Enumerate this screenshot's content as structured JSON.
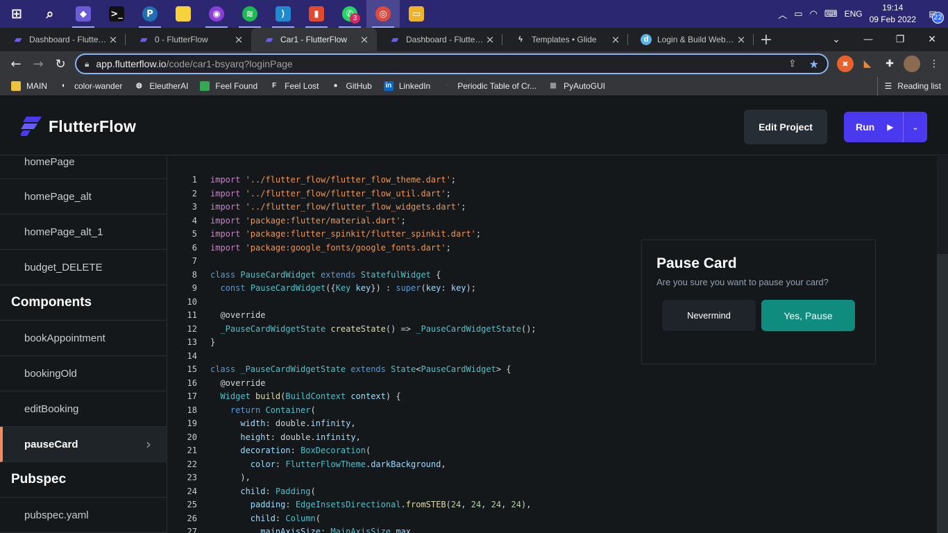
{
  "taskbar": {
    "icons": [
      {
        "name": "windows-start",
        "glyph": "⊞",
        "bg": "transparent"
      },
      {
        "name": "search",
        "glyph": "⌕",
        "bg": "transparent"
      },
      {
        "name": "git-app",
        "glyph": "◆",
        "bg": "#6b5bd6"
      },
      {
        "name": "terminal",
        "glyph": ">_",
        "bg": "#111"
      },
      {
        "name": "pycharm-edu",
        "glyph": "P",
        "bg": "#1f6fb2"
      },
      {
        "name": "sticky-notes",
        "glyph": "",
        "bg": "#f7d23c"
      },
      {
        "name": "podcast-app",
        "glyph": "◉",
        "bg": "#8b3fd8"
      },
      {
        "name": "spotify",
        "glyph": "≋",
        "bg": "#1db954"
      },
      {
        "name": "vscode",
        "glyph": "⟩",
        "bg": "#1f8ad2"
      },
      {
        "name": "office",
        "glyph": "▮",
        "bg": "#e24a2e"
      },
      {
        "name": "whatsapp",
        "glyph": "✆",
        "bg": "#25d366",
        "badge": "3"
      },
      {
        "name": "chrome",
        "glyph": "◎",
        "bg": "#dd4b3e"
      },
      {
        "name": "file-explorer",
        "glyph": "▭",
        "bg": "#f0b429"
      }
    ],
    "tray": {
      "language": "ENG",
      "time": "19:14",
      "date": "09 Feb 2022",
      "notifications": "22"
    }
  },
  "tabs": [
    {
      "title": "Dashboard - FlutterFlow",
      "favicon": "flutterflow",
      "active": false
    },
    {
      "title": "0 - FlutterFlow",
      "favicon": "flutterflow",
      "active": false
    },
    {
      "title": "Car1 - FlutterFlow",
      "favicon": "flutterflow",
      "active": true
    },
    {
      "title": "Dashboard - FlutterFlow",
      "favicon": "flutterflow",
      "active": false
    },
    {
      "title": "Templates • Glide",
      "favicon": "glide",
      "active": false
    },
    {
      "title": "Login & Build Web Apps",
      "favicon": "d-app",
      "active": false
    }
  ],
  "address": {
    "host": "app.flutterflow.io",
    "path": "/code/car1-bsyarq?loginPage"
  },
  "bookmarks": [
    {
      "label": "MAIN",
      "icon": "folder-icon",
      "color": "#f0c23c"
    },
    {
      "label": "color-wander",
      "icon": "globe-icon",
      "color": "#e8eaed"
    },
    {
      "label": "EleutherAI",
      "icon": "eleuther-icon",
      "color": "#e8eaed"
    },
    {
      "label": "Feel Found",
      "icon": "feelfound-icon",
      "color": "#34a853"
    },
    {
      "label": "Feel Lost",
      "icon": "f-icon",
      "color": "#e8eaed"
    },
    {
      "label": "GitHub",
      "icon": "github-icon",
      "color": "#e8eaed"
    },
    {
      "label": "LinkedIn",
      "icon": "linkedin-icon",
      "color": "#0a66c2"
    },
    {
      "label": "Periodic Table of Cr...",
      "icon": "periodic-icon",
      "color": "#3c3c3c"
    },
    {
      "label": "PyAutoGUI",
      "icon": "doc-icon",
      "color": "#9aa0a6"
    }
  ],
  "reading_list": "Reading list",
  "header": {
    "logo_text": "FlutterFlow",
    "edit_project": "Edit Project",
    "run": "Run",
    "brand_color": "#4b39ef"
  },
  "sidebar": {
    "pages": [
      "homePage",
      "homePage_alt",
      "homePage_alt_1",
      "budget_DELETE"
    ],
    "components_title": "Components",
    "components": [
      "bookAppointment",
      "bookingOld",
      "editBooking",
      "pauseCard"
    ],
    "selected": "pauseCard",
    "pubspec_title": "Pubspec",
    "pubspec_items": [
      "pubspec.yaml"
    ]
  },
  "code_lines": [
    [
      [
        "kw",
        "import "
      ],
      [
        "str",
        "'../flutter_flow/flutter_flow_theme.dart'"
      ],
      [
        "tx",
        ";"
      ]
    ],
    [
      [
        "kw",
        "import "
      ],
      [
        "str",
        "'../flutter_flow/flutter_flow_util.dart'"
      ],
      [
        "tx",
        ";"
      ]
    ],
    [
      [
        "kw",
        "import "
      ],
      [
        "str",
        "'../flutter_flow/flutter_flow_widgets.dart'"
      ],
      [
        "tx",
        ";"
      ]
    ],
    [
      [
        "kw",
        "import "
      ],
      [
        "str",
        "'package:flutter/material.dart'"
      ],
      [
        "tx",
        ";"
      ]
    ],
    [
      [
        "kw",
        "import "
      ],
      [
        "str",
        "'package:flutter_spinkit/flutter_spinkit.dart'"
      ],
      [
        "tx",
        ";"
      ]
    ],
    [
      [
        "kw",
        "import "
      ],
      [
        "str",
        "'package:google_fonts/google_fonts.dart'"
      ],
      [
        "tx",
        ";"
      ]
    ],
    [],
    [
      [
        "kb",
        "class "
      ],
      [
        "ty",
        "PauseCardWidget "
      ],
      [
        "kb",
        "extends "
      ],
      [
        "ty",
        "StatefulWidget"
      ],
      [
        "tx",
        " {"
      ]
    ],
    [
      [
        "tx",
        "  "
      ],
      [
        "kb",
        "const "
      ],
      [
        "ty",
        "PauseCardWidget"
      ],
      [
        "tx",
        "({"
      ],
      [
        "ty",
        "Key"
      ],
      [
        "pm",
        " key"
      ],
      [
        "tx",
        "}) : "
      ],
      [
        "kb",
        "super"
      ],
      [
        "tx",
        "("
      ],
      [
        "pm",
        "key"
      ],
      [
        "tx",
        ": "
      ],
      [
        "pm",
        "key"
      ],
      [
        "tx",
        ");"
      ]
    ],
    [],
    [
      [
        "tx",
        "  @override"
      ]
    ],
    [
      [
        "tx",
        "  "
      ],
      [
        "ty",
        "_PauseCardWidgetState "
      ],
      [
        "fn",
        "createState"
      ],
      [
        "tx",
        "() => "
      ],
      [
        "ty",
        "_PauseCardWidgetState"
      ],
      [
        "tx",
        "();"
      ]
    ],
    [
      [
        "tx",
        "}"
      ]
    ],
    [],
    [
      [
        "kb",
        "class "
      ],
      [
        "ty",
        "_PauseCardWidgetState "
      ],
      [
        "kb",
        "extends "
      ],
      [
        "ty",
        "State"
      ],
      [
        "tx",
        "<"
      ],
      [
        "ty",
        "PauseCardWidget"
      ],
      [
        "tx",
        "> {"
      ]
    ],
    [
      [
        "tx",
        "  @override"
      ]
    ],
    [
      [
        "tx",
        "  "
      ],
      [
        "ty",
        "Widget "
      ],
      [
        "fn",
        "build"
      ],
      [
        "tx",
        "("
      ],
      [
        "ty",
        "BuildContext "
      ],
      [
        "pm",
        "context"
      ],
      [
        "tx",
        ") {"
      ]
    ],
    [
      [
        "tx",
        "    "
      ],
      [
        "kb",
        "return "
      ],
      [
        "ty",
        "Container"
      ],
      [
        "tx",
        "("
      ]
    ],
    [
      [
        "tx",
        "      "
      ],
      [
        "pm",
        "width"
      ],
      [
        "tx",
        ": double."
      ],
      [
        "pm",
        "infinity"
      ],
      [
        "tx",
        ","
      ]
    ],
    [
      [
        "tx",
        "      "
      ],
      [
        "pm",
        "height"
      ],
      [
        "tx",
        ": double."
      ],
      [
        "pm",
        "infinity"
      ],
      [
        "tx",
        ","
      ]
    ],
    [
      [
        "tx",
        "      "
      ],
      [
        "pm",
        "decoration"
      ],
      [
        "tx",
        ": "
      ],
      [
        "ty",
        "BoxDecoration"
      ],
      [
        "tx",
        "("
      ]
    ],
    [
      [
        "tx",
        "        "
      ],
      [
        "pm",
        "color"
      ],
      [
        "tx",
        ": "
      ],
      [
        "ty",
        "FlutterFlowTheme"
      ],
      [
        "tx",
        "."
      ],
      [
        "pm",
        "darkBackground"
      ],
      [
        "tx",
        ","
      ]
    ],
    [
      [
        "tx",
        "      ),"
      ]
    ],
    [
      [
        "tx",
        "      "
      ],
      [
        "pm",
        "child"
      ],
      [
        "tx",
        ": "
      ],
      [
        "ty",
        "Padding"
      ],
      [
        "tx",
        "("
      ]
    ],
    [
      [
        "tx",
        "        "
      ],
      [
        "pm",
        "padding"
      ],
      [
        "tx",
        ": "
      ],
      [
        "ty",
        "EdgeInsetsDirectional"
      ],
      [
        "tx",
        "."
      ],
      [
        "fn",
        "fromSTEB"
      ],
      [
        "tx",
        "("
      ],
      [
        "nm",
        "24"
      ],
      [
        "tx",
        ", "
      ],
      [
        "nm",
        "24"
      ],
      [
        "tx",
        ", "
      ],
      [
        "nm",
        "24"
      ],
      [
        "tx",
        ", "
      ],
      [
        "nm",
        "24"
      ],
      [
        "tx",
        "),"
      ]
    ],
    [
      [
        "tx",
        "        "
      ],
      [
        "pm",
        "child"
      ],
      [
        "tx",
        ": "
      ],
      [
        "ty",
        "Column"
      ],
      [
        "tx",
        "("
      ]
    ],
    [
      [
        "tx",
        "          "
      ],
      [
        "pm",
        "mainAxisSize"
      ],
      [
        "tx",
        ": "
      ],
      [
        "ty",
        "MainAxisSize"
      ],
      [
        "tx",
        "."
      ],
      [
        "pm",
        "max"
      ],
      [
        "tx",
        ","
      ]
    ]
  ],
  "preview": {
    "title": "Pause Card",
    "subtitle": "Are you sure you want to pause your card?",
    "cancel": "Nevermind",
    "confirm": "Yes, Pause",
    "confirm_color": "#0f8c7d"
  }
}
